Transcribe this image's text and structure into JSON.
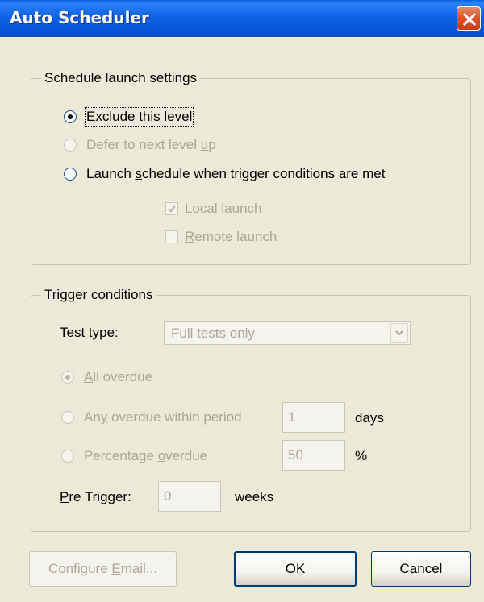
{
  "window": {
    "title": "Auto Scheduler"
  },
  "schedule_group": {
    "legend": "Schedule launch settings",
    "options": [
      {
        "pre": "",
        "key": "E",
        "post": "xclude this level",
        "checked": true,
        "enabled": true
      },
      {
        "pre": "Defer to next level ",
        "key": "u",
        "post": "p",
        "checked": false,
        "enabled": false
      },
      {
        "pre": "Launch ",
        "key": "s",
        "post": "chedule when trigger conditions are met",
        "checked": false,
        "enabled": true
      }
    ],
    "checkboxes": [
      {
        "key": "L",
        "post": "ocal launch",
        "checked": true,
        "enabled": false
      },
      {
        "key": "R",
        "post": "emote launch",
        "checked": false,
        "enabled": false
      }
    ]
  },
  "trigger_group": {
    "legend": "Trigger conditions",
    "test_type": {
      "key": "T",
      "post": "est type:",
      "value": "Full tests only"
    },
    "options": [
      {
        "key": "A",
        "post": "ll overdue",
        "checked": true,
        "enabled": false
      },
      {
        "pre": "An",
        "key": "y",
        "post": " overdue within period",
        "checked": false,
        "enabled": false,
        "value": "1",
        "unit": "days"
      },
      {
        "pre": "Percentage ",
        "key": "o",
        "post": "verdue",
        "checked": false,
        "enabled": false,
        "value": "50",
        "unit": "%"
      }
    ],
    "pre_trigger": {
      "key": "P",
      "post": "re Trigger:",
      "value": "0",
      "unit": "weeks"
    }
  },
  "buttons": {
    "configure_pre": "Configure ",
    "configure_key": "E",
    "configure_post": "mail...",
    "ok": "OK",
    "cancel": "Cancel"
  }
}
